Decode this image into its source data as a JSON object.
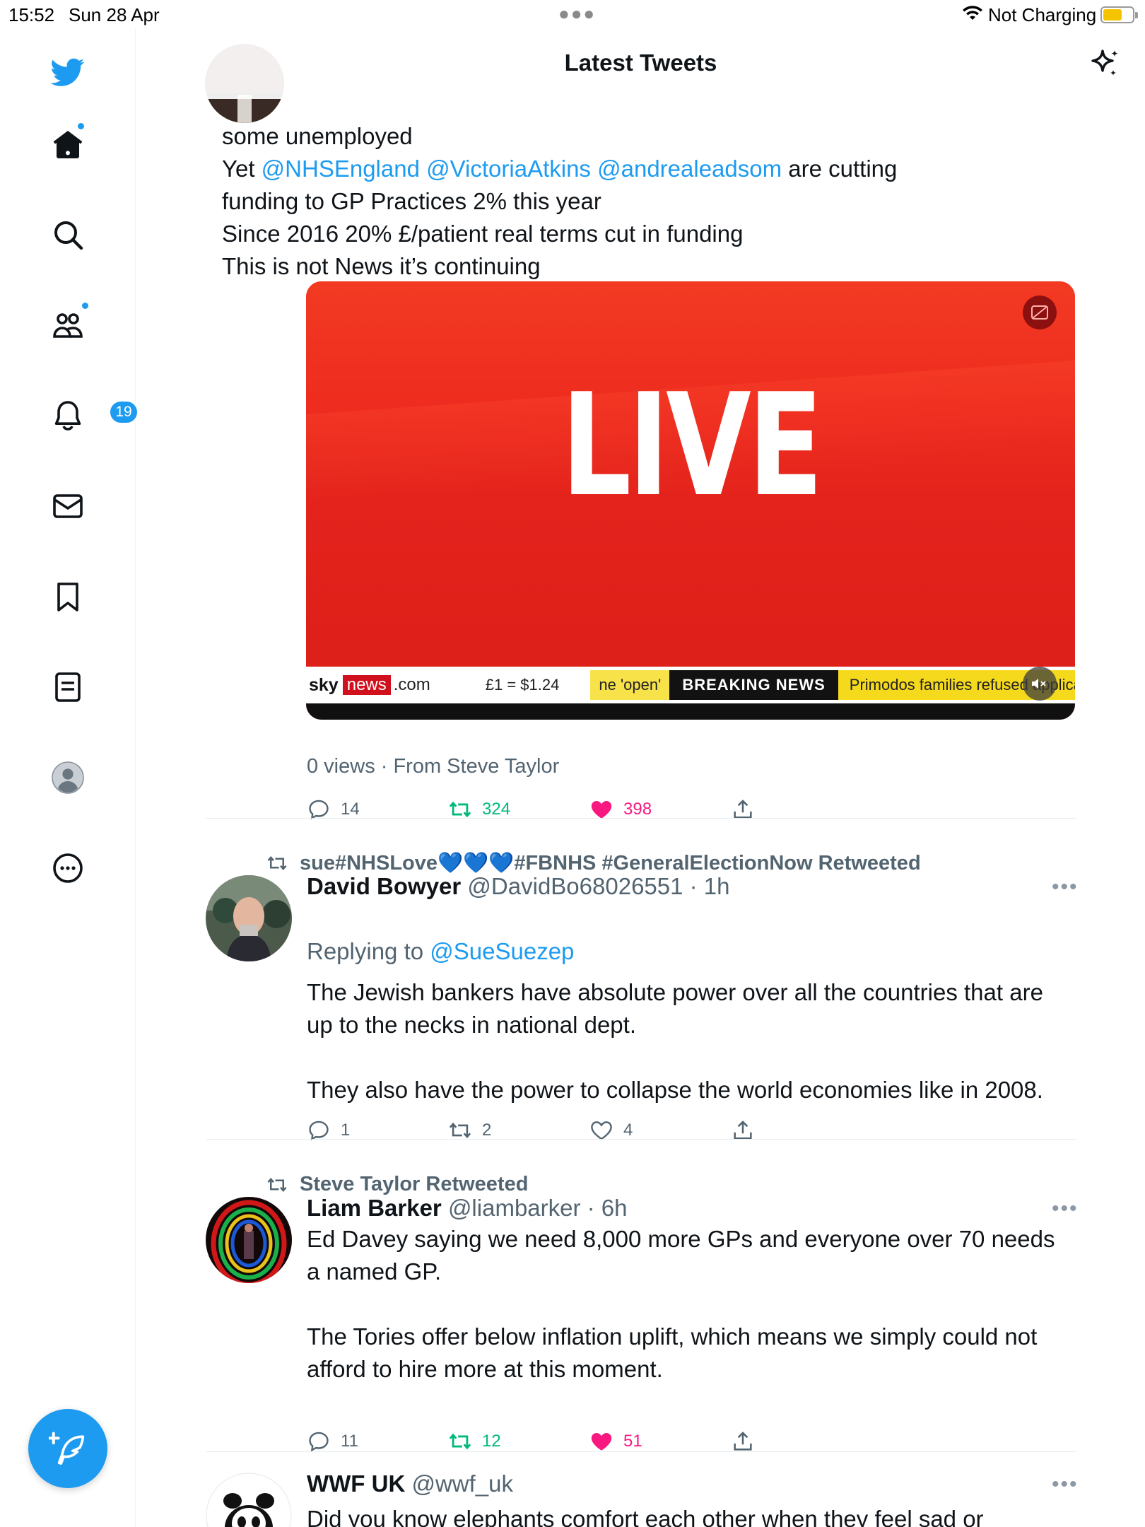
{
  "status_bar": {
    "time": "15:52",
    "date": "Sun 28 Apr",
    "charging": "Not Charging",
    "battery_color": "#f5c400"
  },
  "sidebar": {
    "notification_badge": "19",
    "accent": "#1d9bf0"
  },
  "header": {
    "title": "Latest Tweets"
  },
  "tweet1": {
    "text_lines": [
      "some unemployed",
      "are cutting",
      "funding to GP Practices 2% this year",
      "Since 2016 20% £/patient real terms cut in funding",
      "This is not News it’s continuing"
    ],
    "yet_prefix": "Yet ",
    "mentions": [
      "@NHSEngland",
      "@VictoriaAtkins",
      "@andrealeadsom"
    ],
    "video": {
      "live_text": "LIVE",
      "brand_sky": "sky",
      "brand_news": "news",
      "brand_com": ".com",
      "fx": "£1 = $1.24",
      "open": "ne 'open'",
      "breaking": "BREAKING NEWS",
      "headline": "Primodos families refused applicati"
    },
    "views": "0 views · From Steve Taylor",
    "replies": "14",
    "retweets": "324",
    "likes": "398",
    "retweeted": true,
    "liked": true
  },
  "tweet2": {
    "retweeted_by": "sue#NHSLove💙💙💙#FBNHS #GeneralElectionNow Retweeted",
    "name": "David Bowyer",
    "handle_time": "@DavidBo68026551 · 1h",
    "replying_prefix": "Replying to ",
    "replying_to": "@SueSuezep",
    "text_lines": [
      "The Jewish bankers have absolute power over all the countries that are",
      "up to the necks in national dept.",
      "",
      "They also have the power to collapse the world economies like in 2008."
    ],
    "replies": "1",
    "retweets": "2",
    "likes": "4"
  },
  "tweet3": {
    "retweeted_by": "Steve Taylor Retweeted",
    "name": "Liam Barker",
    "handle_time": "@liambarker · 6h",
    "text_lines": [
      "Ed Davey saying we need 8,000 more GPs and everyone over 70 needs",
      "a named GP.",
      "",
      "The Tories offer below inflation uplift, which means we simply could not",
      "afford to hire more at this moment."
    ],
    "replies": "11",
    "retweets": "12",
    "likes": "51",
    "retweeted": true,
    "liked": true
  },
  "tweet4": {
    "name": "WWF UK",
    "handle_time": "@wwf_uk",
    "text_line": "Did you know elephants comfort each other when they feel sad or"
  },
  "colors": {
    "retweet_green": "#00ba7c",
    "like_pink": "#f91880",
    "muted": "#536471"
  }
}
